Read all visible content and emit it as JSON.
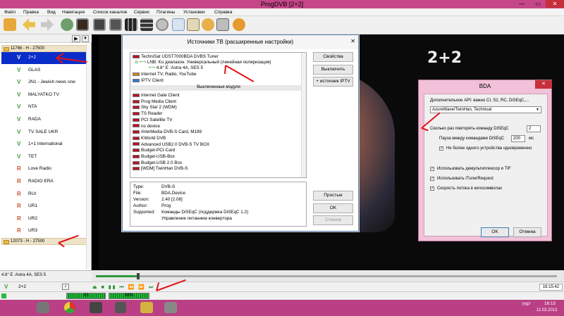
{
  "app": {
    "title": "ProgDVB [2+2]"
  },
  "menu": [
    "Файл",
    "Правка",
    "Вид",
    "Навигация",
    "Список каналов",
    "Сервис",
    "Плагины",
    "Установки",
    "Справка"
  ],
  "groups": [
    {
      "name": "11766 - H - 27500"
    },
    {
      "name": "12073 - H - 27500"
    }
  ],
  "channels": [
    {
      "name": "2+2",
      "type": "V",
      "selected": true
    },
    {
      "name": "GLAS",
      "type": "V"
    },
    {
      "name": "JN1 - Jewish news one",
      "type": "V"
    },
    {
      "name": "MALYATKO TV",
      "type": "V"
    },
    {
      "name": "NTA",
      "type": "V"
    },
    {
      "name": "RADA",
      "type": "V"
    },
    {
      "name": "TV SALE UKR",
      "type": "V"
    },
    {
      "name": "1+1 International",
      "type": "V"
    },
    {
      "name": "TET",
      "type": "V"
    },
    {
      "name": "Love Radio",
      "type": "R"
    },
    {
      "name": "RADIO ERA",
      "type": "R"
    },
    {
      "name": "RUI",
      "type": "R"
    },
    {
      "name": "UR1",
      "type": "R"
    },
    {
      "name": "UR2",
      "type": "R"
    },
    {
      "name": "UR3",
      "type": "R"
    }
  ],
  "status": {
    "satellite": "4.8° E :Astra 4A, SES 5",
    "channel": "2+2",
    "signal": "63",
    "quality": "98%",
    "time": "16:15:42"
  },
  "video": {
    "logo": "2+2"
  },
  "sources_dialog": {
    "title": "Источники ТВ (расширенные настройки)",
    "tuner": "TechniSat UDST7000BDA DVBS Tuner",
    "lnb": "LNB: Ku диапазон. Универсальный (линейная поляризация)",
    "sat": "4.8° E :Astra 4A, SES 5",
    "inet": "Internet TV, Radio, YouTube",
    "iptv": "IPTV Client",
    "disabled_header": "Выключенные модули",
    "disabled": [
      "Internet Gate Client",
      "Prog Media Client",
      "Sky Star 2 (WDM)",
      "TS Reader",
      "PCI Satellite TV",
      "no device",
      "AVerMedia DVB-S Card, M199",
      "KWorld DVB",
      "Advanced USB2.0 DVB-S TV BOX",
      "Budget-PCI-Card",
      "Budget-USB-Box",
      "Budget-USB 2.0 Box",
      "[WDM] TwinHan DVB-S"
    ],
    "info": {
      "type_label": "Type:",
      "type": "DVB-S",
      "file_label": "File:",
      "file": "BDA.Device",
      "version_label": "Version:",
      "version": "2.40 [2.08]",
      "author_label": "Author:",
      "author": "Prog",
      "supported_label": "Supported:",
      "supported": "Команды DiSEqC (поддержка DiSEqC 1.2)",
      "supported2": "Управление питанием конвертора"
    },
    "buttons": {
      "props": "Свойства",
      "disable": "Выключить",
      "add_iptv": "+ источник IPTV",
      "simple": "Простые",
      "ok": "OK",
      "cancel": "Отмена"
    }
  },
  "bda_dialog": {
    "title": "BDA",
    "api_label": "Дополнительное API: важно CI, S2, RC, DiSEqC,...",
    "api_value": "AzureWave/TwinHan, Technisat",
    "repeat_label": "Сколько раз повторять команду DiSEqC",
    "repeat_value": "2",
    "pause_label": "Пауза между командами DiSEqC",
    "pause_value": "200",
    "pause_unit": "мс",
    "one_device": "Не более одного устройства одновременно",
    "demux": "Использовать демультиплексор и TIF",
    "ituner": "Использовать ITunerRequest",
    "symrate": "Скорость потока в килосимволах",
    "ok": "OK",
    "cancel": "Отмена"
  },
  "taskbar": {
    "time": "16:15",
    "date": "12.03.2013",
    "lang": "УКР"
  }
}
